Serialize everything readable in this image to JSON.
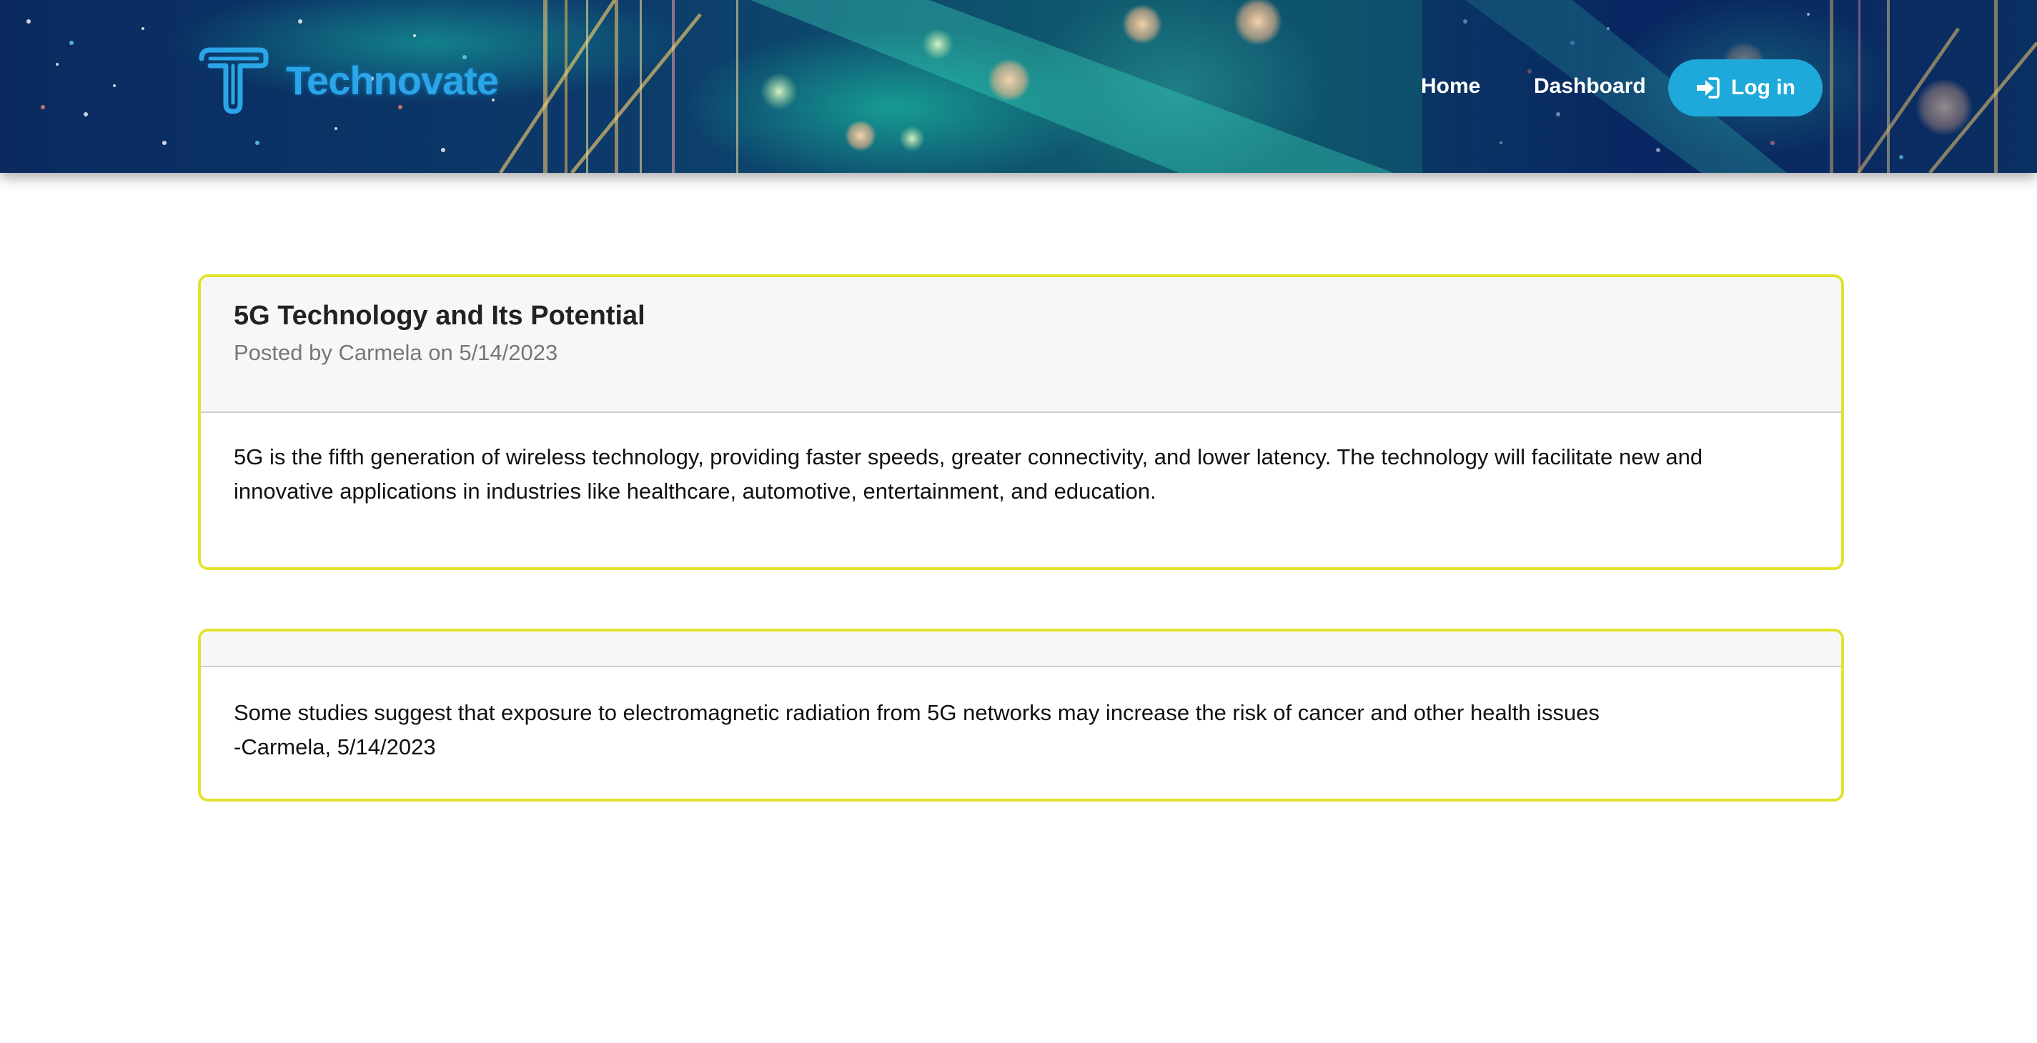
{
  "header": {
    "brand": "Technovate",
    "nav": {
      "home": "Home",
      "dashboard": "Dashboard",
      "login": "Log in"
    },
    "icons": {
      "logo": "technovate-t-logo",
      "login": "sign-in-arrow-icon"
    }
  },
  "post": {
    "title": "5G Technology and Its Potential",
    "meta": "Posted by Carmela on 5/14/2023",
    "body": "5G is the fifth generation of wireless technology, providing faster speeds, greater connectivity, and lower latency. The technology will facilitate new and innovative applications in industries like healthcare, automotive, entertainment, and education."
  },
  "comments": [
    {
      "text": "Some studies suggest that exposure to electromagnetic radiation from 5G networks may increase the risk of cancer and other health issues",
      "signature": "-Carmela, 5/14/2023"
    }
  ],
  "colors": {
    "brand_blue": "#2aa6e8",
    "login_button": "#1fa9da",
    "card_border": "#e2e22e",
    "card_header_bg": "#f7f7f7",
    "meta_text": "#777777"
  }
}
